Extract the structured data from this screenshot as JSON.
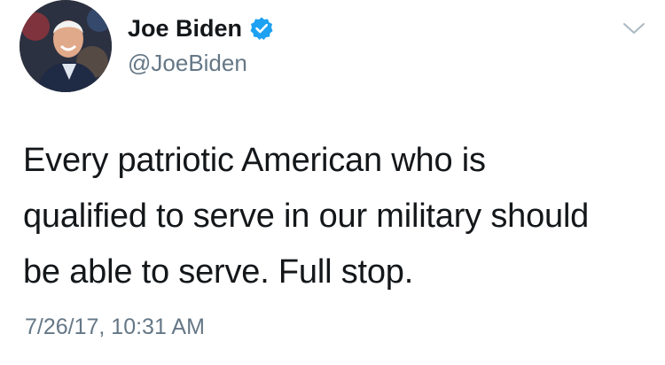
{
  "author": {
    "display_name": "Joe Biden",
    "handle": "@JoeBiden",
    "verified": true,
    "avatar_icon": "profile-photo"
  },
  "tweet": {
    "text": "Every patriotic American who is\nqualified to serve in our military should\nbe able to serve. Full stop.",
    "timestamp": "7/26/17, 10:31 AM"
  },
  "menu": {
    "icon": "chevron-down-icon"
  },
  "colors": {
    "text": "#14171a",
    "secondary": "#657786",
    "verified_blue": "#1da1f2",
    "chevron": "#aab8c2"
  }
}
